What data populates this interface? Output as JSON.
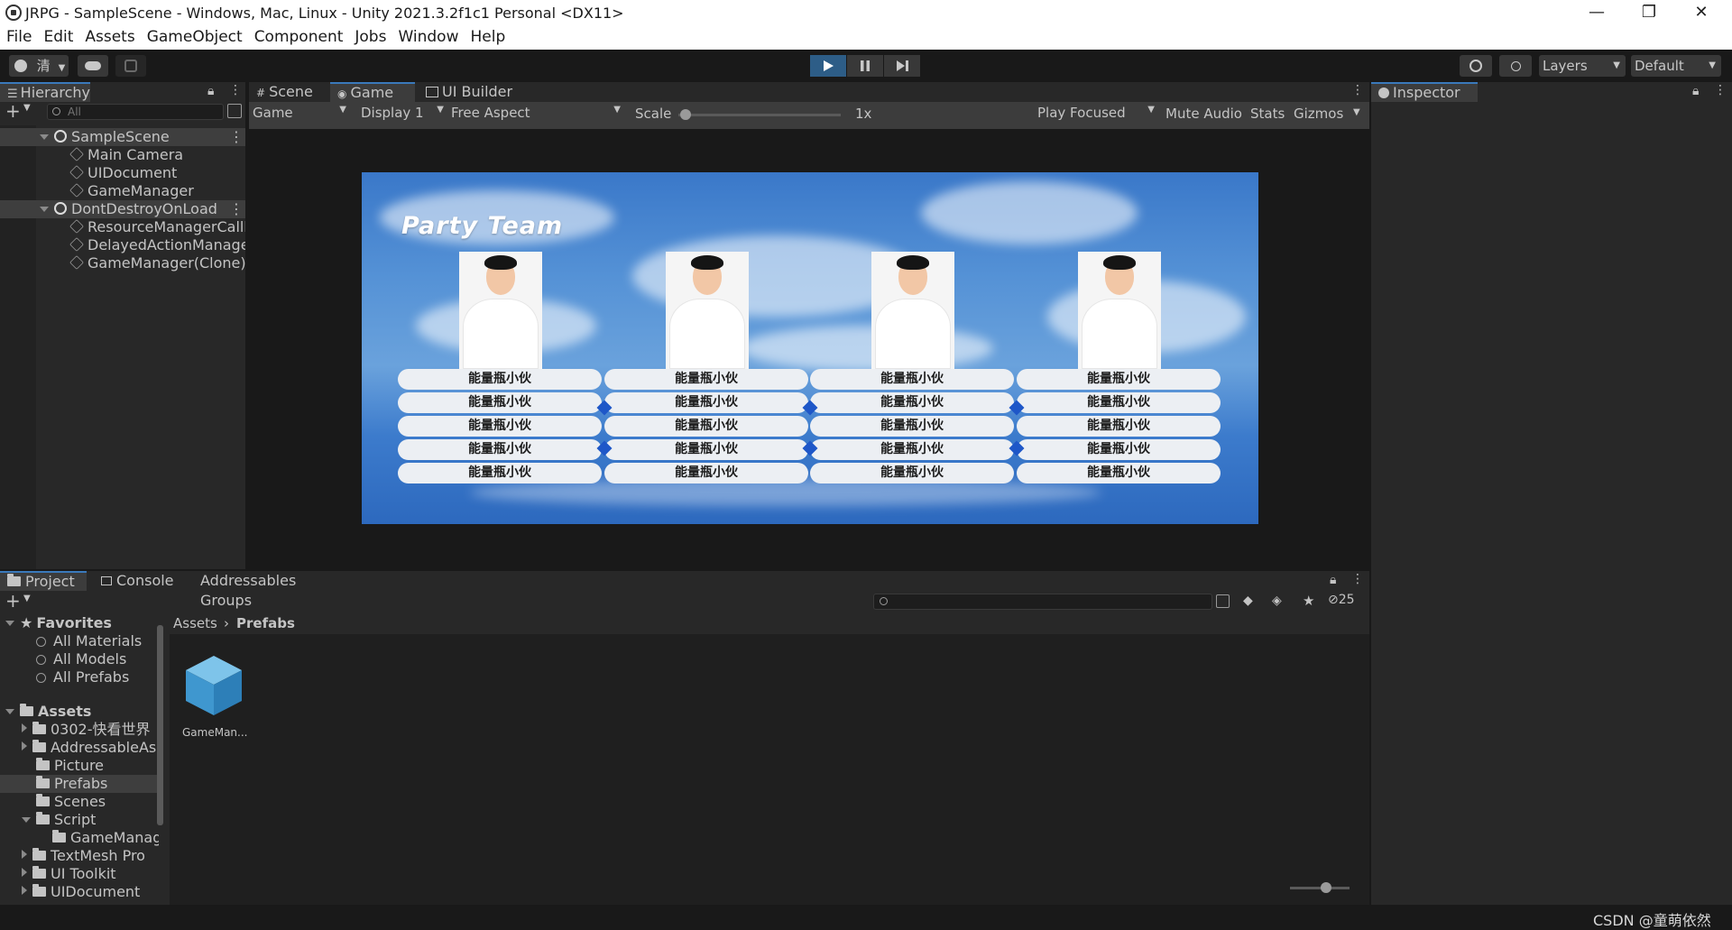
{
  "window": {
    "title": "JRPG - SampleScene - Windows, Mac, Linux - Unity 2021.3.2f1c1 Personal <DX11>",
    "minimize": "—",
    "maximize": "❐",
    "close": "✕"
  },
  "menu": [
    "File",
    "Edit",
    "Assets",
    "GameObject",
    "Component",
    "Jobs",
    "Window",
    "Help"
  ],
  "toolbar": {
    "account_label": "清",
    "layers_label": "Layers",
    "layout_label": "Default"
  },
  "hierarchy": {
    "tab_label": "Hierarchy",
    "search_placeholder": "All",
    "rows": [
      {
        "label": "SampleScene",
        "type": "scene"
      },
      {
        "label": "Main Camera",
        "type": "object"
      },
      {
        "label": "UIDocument",
        "type": "object"
      },
      {
        "label": "GameManager",
        "type": "object"
      },
      {
        "label": "DontDestroyOnLoad",
        "type": "scene"
      },
      {
        "label": "ResourceManagerCallba",
        "type": "object"
      },
      {
        "label": "DelayedActionManager",
        "type": "object"
      },
      {
        "label": "GameManager(Clone)",
        "type": "object"
      }
    ]
  },
  "gameview": {
    "tabs": [
      "Scene",
      "Game",
      "UI Builder"
    ],
    "active_tab": "Game",
    "bar": {
      "mode": "Game",
      "display": "Display 1",
      "aspect": "Free Aspect",
      "scale_label": "Scale",
      "scale_value": "1x",
      "play_focused": "Play Focused",
      "mute_audio": "Mute Audio",
      "stats": "Stats",
      "gizmos": "Gizmos"
    },
    "game": {
      "title": "Party Team",
      "member_name": "能量瓶小伙",
      "slot_rows": 5,
      "slot_columns": 4
    }
  },
  "inspector": {
    "tab_label": "Inspector"
  },
  "project": {
    "tabs": [
      "Project",
      "Console",
      "Addressables Groups"
    ],
    "hidden_count": "25",
    "breadcrumb": [
      "Assets",
      "Prefabs"
    ],
    "favorites_label": "Favorites",
    "favorites": [
      "All Materials",
      "All Models",
      "All Prefabs"
    ],
    "assets_label": "Assets",
    "folders": [
      {
        "label": "0302-快看世界",
        "level": 1,
        "expand": "right"
      },
      {
        "label": "AddressableAss",
        "level": 1,
        "expand": "right"
      },
      {
        "label": "Picture",
        "level": 1,
        "expand": "none"
      },
      {
        "label": "Prefabs",
        "level": 1,
        "expand": "none",
        "selected": true
      },
      {
        "label": "Scenes",
        "level": 1,
        "expand": "none"
      },
      {
        "label": "Script",
        "level": 1,
        "expand": "down"
      },
      {
        "label": "GameManag",
        "level": 2,
        "expand": "none"
      },
      {
        "label": "TextMesh Pro",
        "level": 1,
        "expand": "right"
      },
      {
        "label": "UI Toolkit",
        "level": 1,
        "expand": "right"
      },
      {
        "label": "UIDocument",
        "level": 1,
        "expand": "right"
      }
    ],
    "assets": [
      {
        "label": "GameMan..."
      }
    ]
  },
  "watermark": "CSDN @童萌依然",
  "colors": {
    "accent": "#3a79bb",
    "play_active": "#2d5d87",
    "panel_bg": "#282828",
    "sky": "#3c7bcc"
  }
}
